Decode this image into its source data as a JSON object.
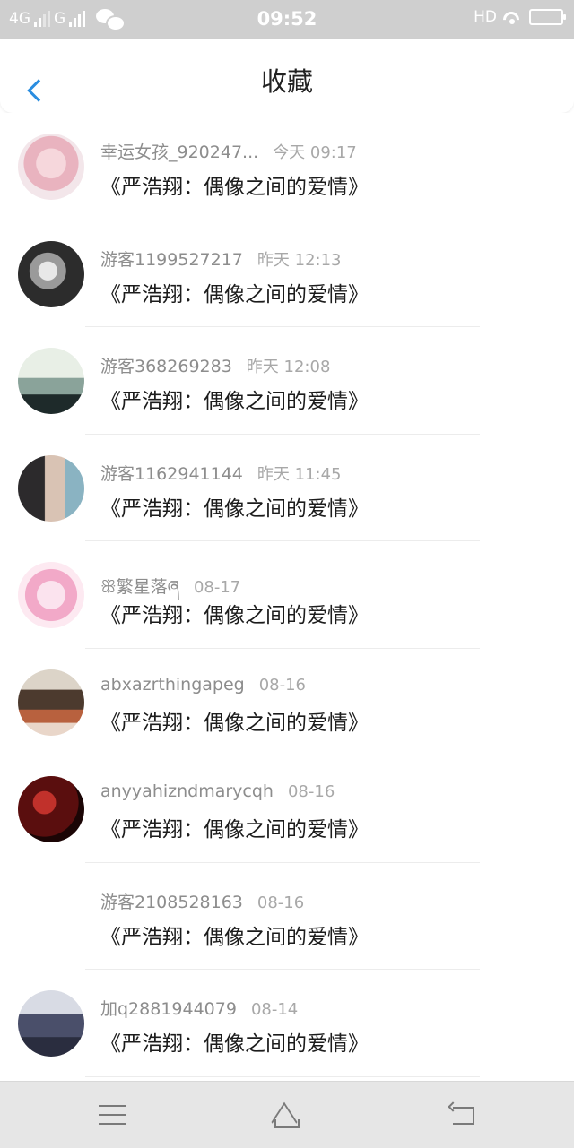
{
  "status_bar": {
    "network_1": "4G",
    "network_2": "G",
    "time": "09:52",
    "hd_label": "HD",
    "icons": [
      "signal-icon",
      "wechat-icon",
      "wifi-icon",
      "battery-icon"
    ]
  },
  "header": {
    "title": "收藏",
    "back_icon": "chevron-left-icon",
    "accent_color": "#2a8de0"
  },
  "list": {
    "items": [
      {
        "name": "幸运女孩_920247...",
        "time": "今天 09:17",
        "text": "《严浩翔：偶像之间的爱情》"
      },
      {
        "name": "游客1199527217",
        "time": "昨天 12:13",
        "text": "《严浩翔：偶像之间的爱情》"
      },
      {
        "name": "游客368269283",
        "time": "昨天 12:08",
        "text": "《严浩翔：偶像之间的爱情》"
      },
      {
        "name": "游客1162941144",
        "time": "昨天 11:45",
        "text": "《严浩翔：偶像之间的爱情》"
      },
      {
        "name": "ꕥ繁星落ཞ",
        "time": "08-17",
        "text": "《严浩翔：偶像之间的爱情》"
      },
      {
        "name": "abxazrthingapeg",
        "time": "08-16",
        "text": "《严浩翔：偶像之间的爱情》"
      },
      {
        "name": "anyyahizndmarycqh",
        "time": "08-16",
        "text": "《严浩翔：偶像之间的爱情》"
      },
      {
        "name": "游客2108528163",
        "time": "08-16",
        "text": "《严浩翔：偶像之间的爱情》"
      },
      {
        "name": "加q2881944079",
        "time": "08-14",
        "text": "《严浩翔：偶像之间的爱情》"
      }
    ]
  },
  "nav_bar": {
    "icons": [
      "menu-icon",
      "home-icon",
      "back-icon"
    ]
  }
}
